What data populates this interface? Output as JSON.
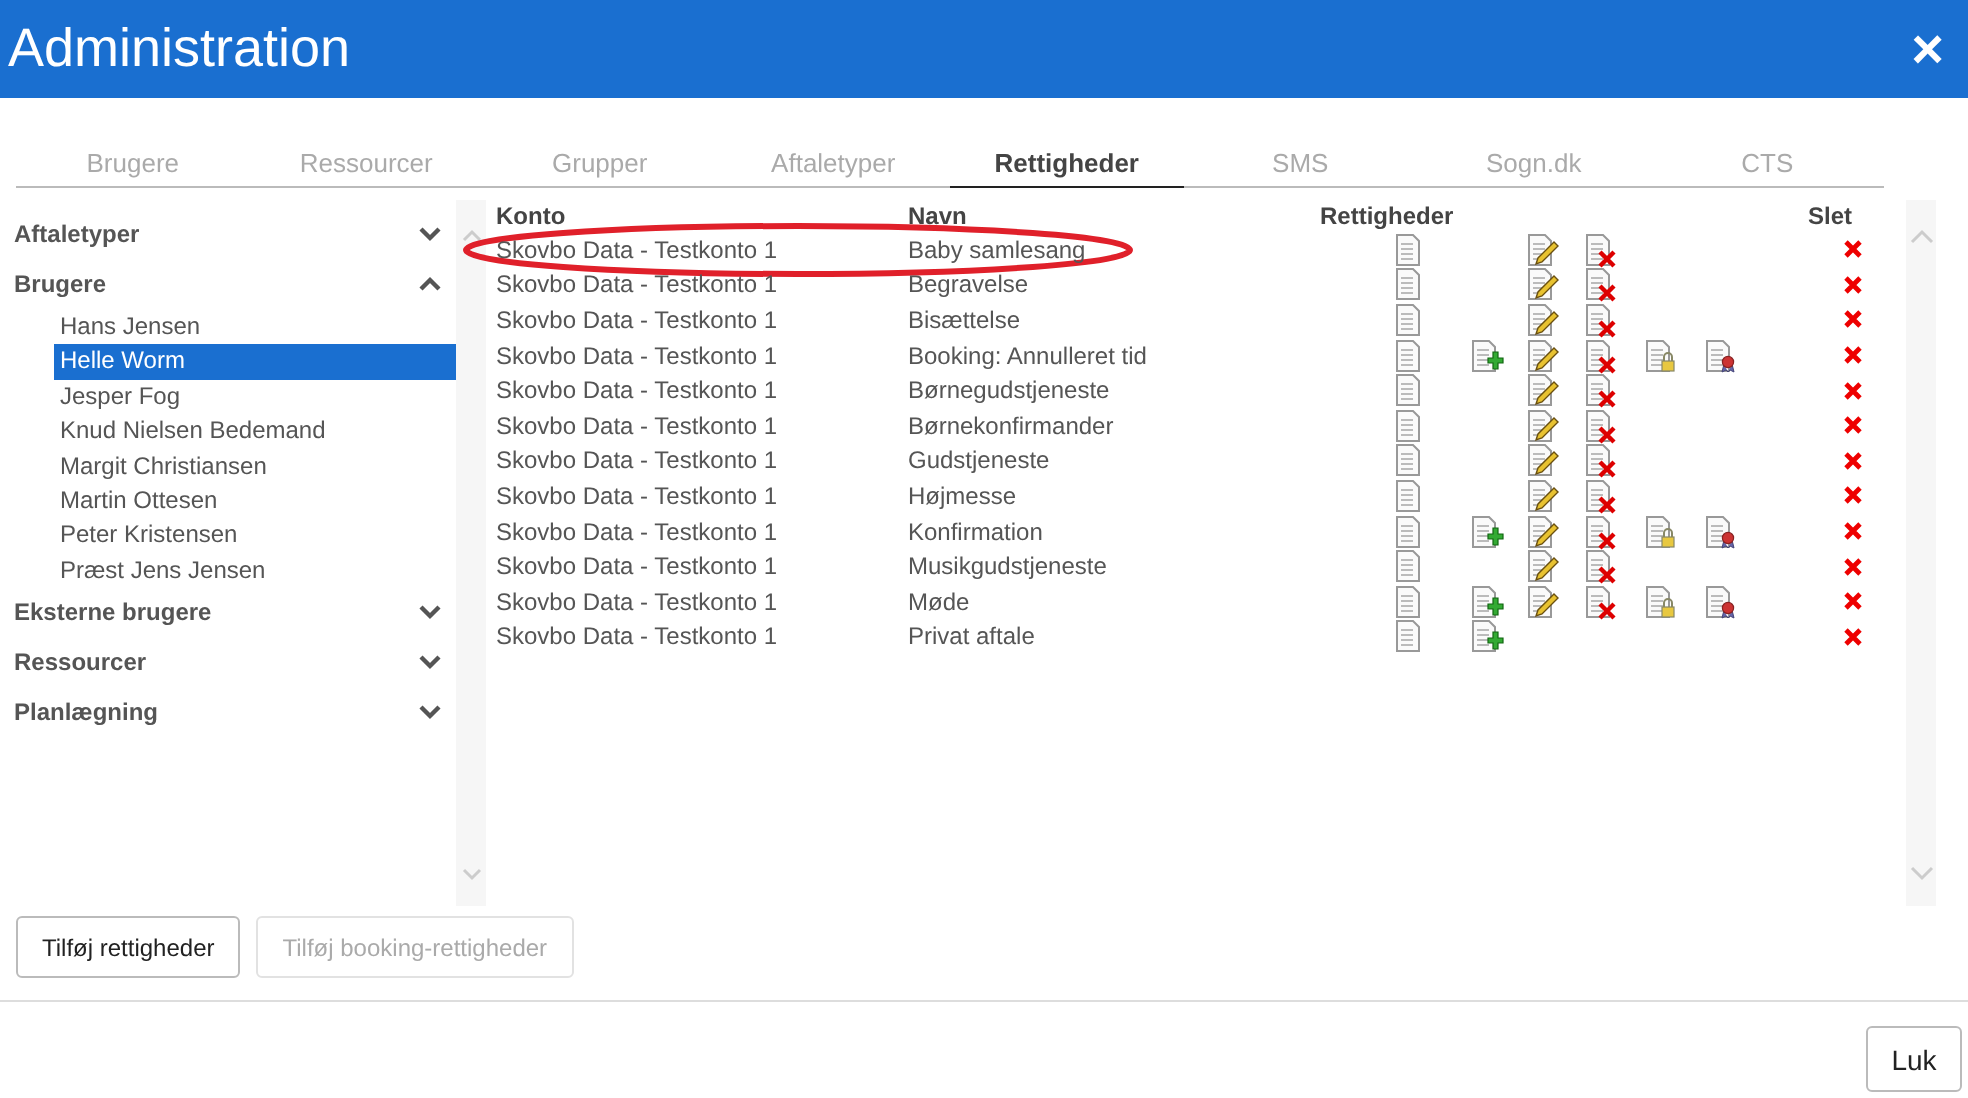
{
  "window": {
    "title": "Administration",
    "close": "×"
  },
  "tabs": [
    {
      "label": "Brugere",
      "selected": false
    },
    {
      "label": "Ressourcer",
      "selected": false
    },
    {
      "label": "Grupper",
      "selected": false
    },
    {
      "label": "Aftaletyper",
      "selected": false
    },
    {
      "label": "Rettigheder",
      "selected": true
    },
    {
      "label": "SMS",
      "selected": false
    },
    {
      "label": "Sogn.dk",
      "selected": false
    },
    {
      "label": "CTS",
      "selected": false
    }
  ],
  "sidebar": {
    "groups": [
      {
        "label": "Aftaletyper",
        "expanded": false
      },
      {
        "label": "Brugere",
        "expanded": true,
        "items": [
          {
            "label": "Hans Jensen",
            "selected": false
          },
          {
            "label": "Helle Worm",
            "selected": true
          },
          {
            "label": "Jesper Fog",
            "selected": false
          },
          {
            "label": "Knud Nielsen Bedemand",
            "selected": false
          },
          {
            "label": "Margit Christiansen",
            "selected": false
          },
          {
            "label": "Martin Ottesen",
            "selected": false
          },
          {
            "label": "Peter Kristensen",
            "selected": false
          },
          {
            "label": "Præst Jens Jensen",
            "selected": false
          }
        ]
      },
      {
        "label": "Eksterne brugere",
        "expanded": false
      },
      {
        "label": "Ressourcer",
        "expanded": false
      },
      {
        "label": "Planlægning",
        "expanded": false
      }
    ]
  },
  "table": {
    "columns": [
      "Konto",
      "Navn",
      "Rettigheder",
      "Slet"
    ],
    "rows": [
      {
        "konto": "Skovbo Data - Testkonto 1",
        "navn": "Baby samlesang",
        "circled": true,
        "read": true,
        "create": false,
        "edit": true,
        "delete": true,
        "lock": false,
        "approve": false
      },
      {
        "konto": "Skovbo Data - Testkonto 1",
        "navn": "Begravelse",
        "circled": false,
        "read": true,
        "create": false,
        "edit": true,
        "delete": true,
        "lock": false,
        "approve": false
      },
      {
        "konto": "Skovbo Data - Testkonto 1",
        "navn": "Bisættelse",
        "circled": false,
        "read": true,
        "create": false,
        "edit": true,
        "delete": true,
        "lock": false,
        "approve": false
      },
      {
        "konto": "Skovbo Data - Testkonto 1",
        "navn": "Booking: Annulleret tid",
        "circled": false,
        "read": true,
        "create": true,
        "edit": true,
        "delete": true,
        "lock": true,
        "approve": true
      },
      {
        "konto": "Skovbo Data - Testkonto 1",
        "navn": "Børnegudstjeneste",
        "circled": false,
        "read": true,
        "create": false,
        "edit": true,
        "delete": true,
        "lock": false,
        "approve": false
      },
      {
        "konto": "Skovbo Data - Testkonto 1",
        "navn": "Børnekonfirmander",
        "circled": false,
        "read": true,
        "create": false,
        "edit": true,
        "delete": true,
        "lock": false,
        "approve": false
      },
      {
        "konto": "Skovbo Data - Testkonto 1",
        "navn": "Gudstjeneste",
        "circled": false,
        "read": true,
        "create": false,
        "edit": true,
        "delete": true,
        "lock": false,
        "approve": false
      },
      {
        "konto": "Skovbo Data - Testkonto 1",
        "navn": "Højmesse",
        "circled": false,
        "read": true,
        "create": false,
        "edit": true,
        "delete": true,
        "lock": false,
        "approve": false
      },
      {
        "konto": "Skovbo Data - Testkonto 1",
        "navn": "Konfirmation",
        "circled": false,
        "read": true,
        "create": true,
        "edit": true,
        "delete": true,
        "lock": true,
        "approve": true
      },
      {
        "konto": "Skovbo Data - Testkonto 1",
        "navn": "Musikgudstjeneste",
        "circled": false,
        "read": true,
        "create": false,
        "edit": true,
        "delete": true,
        "lock": false,
        "approve": false
      },
      {
        "konto": "Skovbo Data - Testkonto 1",
        "navn": "Møde",
        "circled": false,
        "read": true,
        "create": true,
        "edit": true,
        "delete": true,
        "lock": true,
        "approve": true
      },
      {
        "konto": "Skovbo Data - Testkonto 1",
        "navn": "Privat aftale",
        "circled": false,
        "read": true,
        "create": true,
        "edit": false,
        "delete": false,
        "lock": false,
        "approve": false
      }
    ]
  },
  "buttons": [
    {
      "label": "Tilføj rettigheder",
      "disabled": false
    },
    {
      "label": "Tilføj booking-rettigheder",
      "disabled": true
    }
  ],
  "footer": {
    "close_button": "Luk"
  }
}
